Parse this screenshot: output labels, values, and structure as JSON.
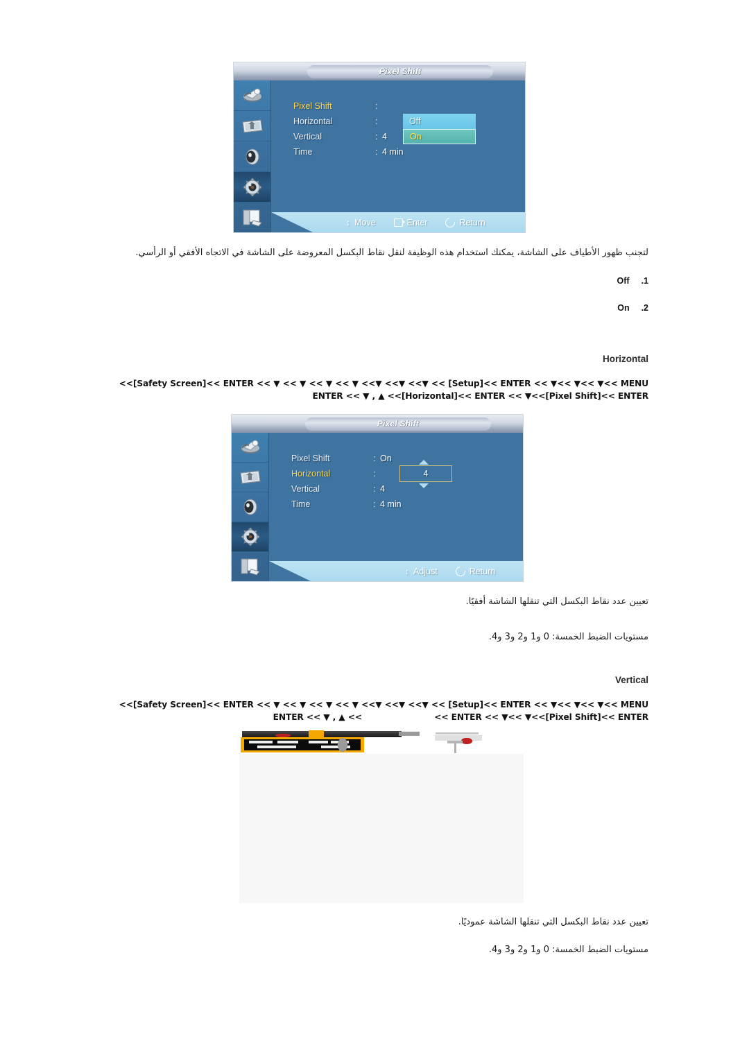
{
  "page": {
    "language": "ar",
    "background": "#ffffff"
  },
  "osd_panel_1": {
    "title": "Pixel Shift",
    "rows": [
      {
        "label": "Pixel Shift",
        "colon": ":",
        "value": "",
        "highlighted": true
      },
      {
        "label": "Horizontal",
        "colon": ":",
        "value": "",
        "highlighted": false
      },
      {
        "label": "Vertical",
        "colon": ":",
        "value": "4",
        "highlighted": false
      },
      {
        "label": "Time",
        "colon": ":",
        "value": "4 min",
        "highlighted": false
      }
    ],
    "dropdown": {
      "options": [
        "Off",
        "On"
      ],
      "selected": "On",
      "off_bg": "#6fc9ea",
      "on_bg": "#5cb8b1",
      "on_text_color": "#ffe14d"
    },
    "sidebar_icons": [
      "picture-icon",
      "image-setup-icon",
      "sound-speaker-icon",
      "setup-gear-icon",
      "multi-control-icon"
    ],
    "selected_sidebar_index": 3,
    "footer": [
      {
        "icon": "updown-arrow-icon",
        "label": "Move"
      },
      {
        "icon": "enter-key-icon",
        "label": "Enter"
      },
      {
        "icon": "return-arrow-icon",
        "label": "Return"
      }
    ]
  },
  "description_1": "لتجنب ظهور الأطياف على الشاشة، يمكنك استخدام هذه الوظيفة لنقل نقاط البكسل المعروضة على الشاشة في الاتجاه الأفقي أو الرأسي.",
  "options_list": [
    {
      "num": ".1",
      "label": "Off"
    },
    {
      "num": ".2",
      "label": "On"
    }
  ],
  "section_horizontal": {
    "heading": "Horizontal",
    "path_line_1": "<<[Safety Screen]<< ENTER << ▼ << ▼ << ▼ << ▼ <<▼ <<▼ <<▼ << [Setup]<< ENTER << ▼<< ▼<< ▼<< MENU",
    "path_line_2": "ENTER << ▼ , ▲ <<[Horizontal]<< ENTER << ▼<<[Pixel Shift]<< ENTER"
  },
  "osd_panel_2": {
    "title": "Pixel Shift",
    "rows": [
      {
        "label": "Pixel Shift",
        "colon": ":",
        "value": "On",
        "highlighted": false
      },
      {
        "label": "Horizontal",
        "colon": ":",
        "value": "",
        "highlighted": true
      },
      {
        "label": "Vertical",
        "colon": ":",
        "value": "4",
        "highlighted": false
      },
      {
        "label": "Time",
        "colon": ":",
        "value": "4 min",
        "highlighted": false
      }
    ],
    "spinner": {
      "value": "4",
      "up_icon": "up-triangle-icon",
      "down_icon": "down-triangle-icon",
      "border_color": "#cbbd7a"
    },
    "sidebar_icons": [
      "picture-icon",
      "image-setup-icon",
      "sound-speaker-icon",
      "setup-gear-icon",
      "multi-control-icon"
    ],
    "selected_sidebar_index": 3,
    "footer": [
      {
        "icon": "updown-arrow-icon",
        "label": "Adjust"
      },
      {
        "icon": "return-arrow-icon",
        "label": "Return"
      }
    ]
  },
  "description_2_line1": "تعيين عدد نقاط البكسل التي تنقلها الشاشة أفقيًا.",
  "description_2_line2": "مستويات الضبط الخمسة: 0 و1 و2 و3 و4.",
  "section_vertical": {
    "heading": "Vertical",
    "path_line_1": "<<[Safety Screen]<< ENTER << ▼ << ▼ << ▼ << ▼ <<▼ <<▼ <<▼ << [Setup]<< ENTER << ▼<< ▼<< ▼<< MENU",
    "path_line_2_left": "ENTER << ▼ , ▲ <<",
    "path_line_2_right": "<< ENTER << ▼<< ▼<<[Pixel Shift]<< ENTER"
  },
  "broken_image": {
    "alt": "missing-osd-screenshot",
    "state": "partially-rendered"
  },
  "description_3_line1": "تعيين عدد نقاط البكسل التي تنقلها الشاشة عموديًا.",
  "description_3_line2": "مستويات الضبط الخمسة: 0 و1 و2 و3 و4."
}
